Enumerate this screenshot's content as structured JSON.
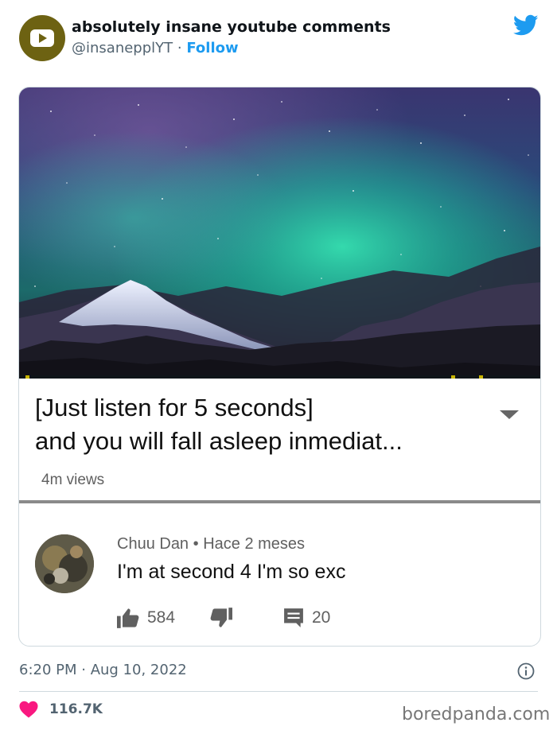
{
  "tweet": {
    "account_name": "absolutely insane youtube comments",
    "handle": "@insanepplYT",
    "separator": "·",
    "follow_label": "Follow",
    "avatar_icon": "youtube-logo-icon",
    "brand_icon": "twitter-bird-icon",
    "timestamp": "6:20 PM · Aug 10, 2022",
    "likes_count": "116.7K",
    "colors": {
      "link": "#1d9bf0",
      "heart": "#f91880",
      "avatar_bg": "#6d6212"
    }
  },
  "screenshot": {
    "video_title_line1": "[Just listen for 5 seconds]",
    "video_title_line2": "and you will fall asleep inmediat...",
    "views": "4m views",
    "comment": {
      "author": "Chuu Dan",
      "bullet": "•",
      "time": "Hace 2 meses",
      "text": "I'm at second 4 I'm so exc",
      "likes": "584",
      "replies": "20"
    }
  },
  "watermark": "boredpanda.com"
}
